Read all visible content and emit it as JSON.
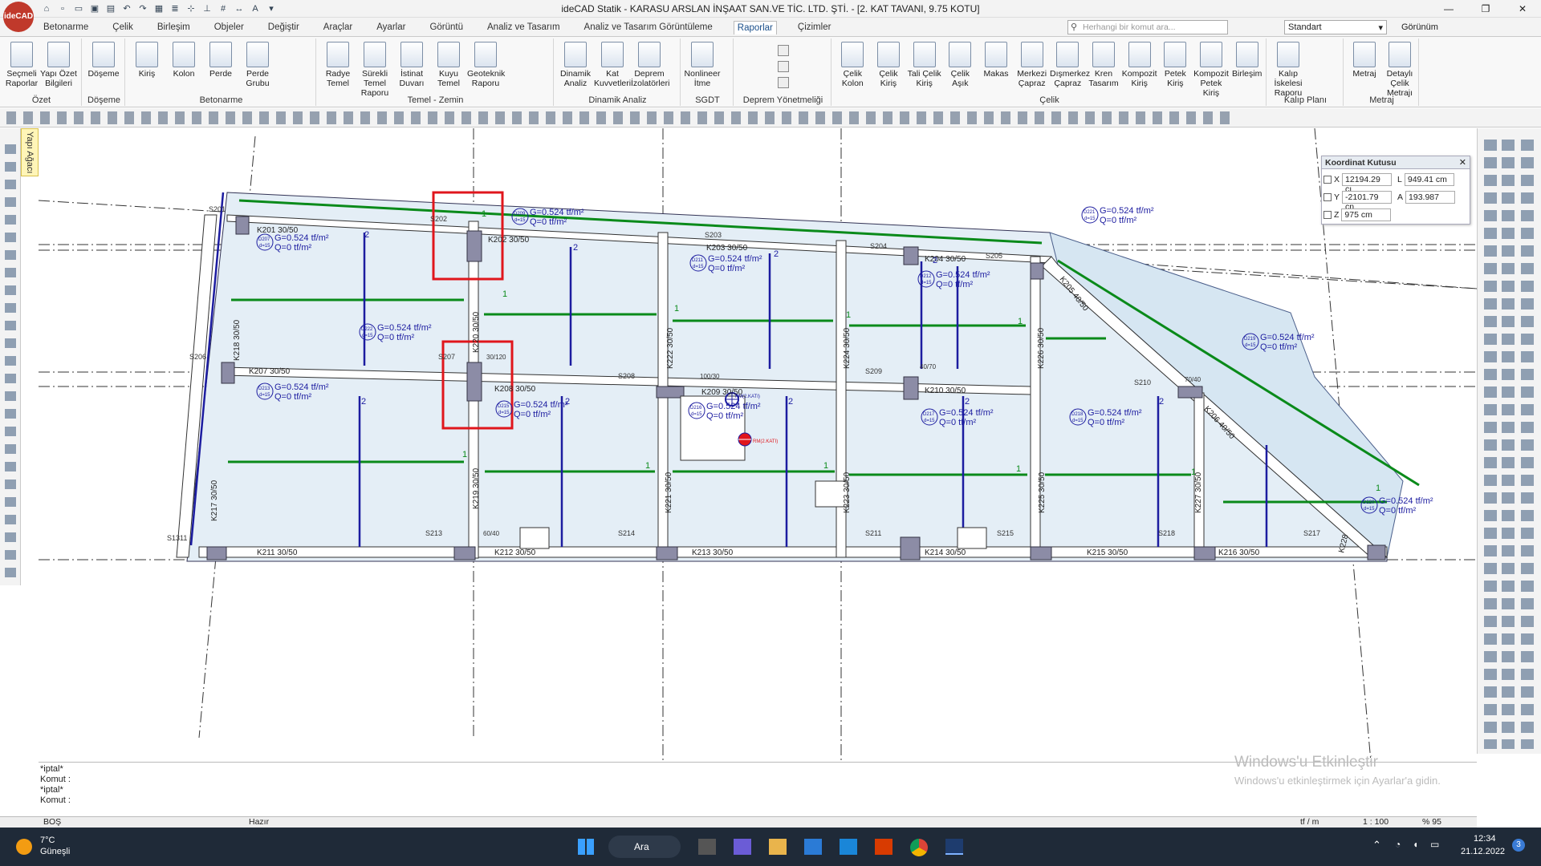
{
  "app": {
    "logo_text": "ideCAD",
    "title": "ideCAD Statik - KARASU ARSLAN İNŞAAT SAN.VE TİC. LTD. ŞTİ. - [2. KAT TAVANI,  9.75 KOTU]",
    "window_controls": [
      "—",
      "❐",
      "✕"
    ]
  },
  "tabs": [
    "Betonarme",
    "Çelik",
    "Birleşim",
    "Objeler",
    "Değiştir",
    "Araçlar",
    "Ayarlar",
    "Görüntü",
    "Analiz ve Tasarım",
    "Analiz ve Tasarım Görüntüleme",
    "Raporlar",
    "Çizimler"
  ],
  "active_tab": "Raporlar",
  "search": {
    "placeholder": "Herhangi bir komut ara..."
  },
  "style_select": "Standart",
  "view_label": "Görünüm",
  "ribbon": {
    "groups": [
      {
        "label": "Özet",
        "buttons": [
          "Seçmeli\nRaporlar",
          "Yapı Özet\nBilgileri"
        ]
      },
      {
        "label": "Döşeme",
        "buttons": [
          "Döşeme"
        ]
      },
      {
        "label": "Betonarme",
        "buttons": [
          "Kiriş",
          "Kolon",
          "Perde",
          "Perde\nGrubu"
        ]
      },
      {
        "label": "Temel - Zemin",
        "buttons": [
          "Radye\nTemel",
          "Sürekli Temel\nRaporu",
          "İstinat\nDuvarı",
          "Kuyu\nTemel",
          "Geoteknik\nRaporu"
        ]
      },
      {
        "label": "Dinamik Analiz",
        "buttons": [
          "Dinamik\nAnaliz",
          "Kat\nKuvvetleri",
          "Deprem\nİzolatörleri"
        ]
      },
      {
        "label": "SGDT",
        "buttons": [
          "Nonlineer\nİtme"
        ]
      },
      {
        "label": "Deprem Yönetmeliği",
        "buttons": []
      },
      {
        "label": "Çelik",
        "buttons": [
          "Çelik\nKolon",
          "Çelik\nKiriş",
          "Tali Çelik\nKiriş",
          "Çelik\nAşık",
          "Makas",
          "Merkezi\nÇapraz",
          "Dışmerkez\nÇapraz",
          "Kren\nTasarım",
          "Kompozit\nKiriş",
          "Petek\nKiriş",
          "Kompozit\nPetek Kiriş",
          "Birleşim"
        ]
      },
      {
        "label": "Kalıp Planı",
        "buttons": [
          "Kalıp İskelesi\nRaporu"
        ]
      },
      {
        "label": "Metraj",
        "buttons": [
          "Metraj",
          "Detaylı Çelik\nMetrajı"
        ]
      }
    ]
  },
  "left_panel_tab": "Yapı Ağacı",
  "coord_box": {
    "title": "Koordinat Kutusu",
    "x_label": "X",
    "x_value": "12194.29 cı",
    "y_label": "Y",
    "y_value": "-2101.79 cn",
    "z_label": "Z",
    "z_value": "975 cm",
    "l_label": "L",
    "l_value": "949.41 cm",
    "a_label": "A",
    "a_value": "193.987"
  },
  "plan": {
    "beams": [
      "K201 30/50",
      "K202 30/50",
      "K203 30/50",
      "K204 30/50",
      "K205 40/50",
      "K206 40/50",
      "K207 30/50",
      "K208 30/50",
      "K209 30/50",
      "K210 30/50",
      "K211 30/50",
      "K212 30/50",
      "K213 30/50",
      "K214 30/50",
      "K215 30/50",
      "K216 30/50",
      "K217 30/50",
      "K218 30/50",
      "K219 30/50",
      "K220 30/50",
      "K221 30/50",
      "K222 30/50",
      "K223 30/50",
      "K224 30/50",
      "K225 30/50",
      "K226 30/50",
      "K227 30/50",
      "K228"
    ],
    "load_g": "G=0.524 tf/m²",
    "load_q": "Q=0 tf/m²",
    "slab_d": "d=15",
    "slabs": [
      "D207",
      "D209",
      "D211",
      "D212",
      "D213",
      "D215",
      "D216",
      "D217",
      "D218",
      "D219",
      "D220",
      "D221",
      "D222"
    ],
    "columns": [
      "S201",
      "S202",
      "S203",
      "S204",
      "S205",
      "S206",
      "S207",
      "S208",
      "S209",
      "S210",
      "S211",
      "S213",
      "S214",
      "S215",
      "S217",
      "S218",
      "S1311"
    ],
    "sizes": [
      "30/120",
      "100/30",
      "40/70",
      "70/40",
      "60/40"
    ],
    "marker_labels": [
      "KM(2.KATI)",
      "RM(2.KATI)"
    ],
    "one": "1",
    "two": "2"
  },
  "command_lines": [
    "*iptal*",
    "Komut :",
    "*iptal*",
    "Komut :"
  ],
  "status": {
    "left": "BOŞ",
    "mid": "Hazır",
    "unit": "tf / m",
    "scale": "1 : 100",
    "zoom": "% 95"
  },
  "watermark": {
    "title": "Windows'u Etkinleştir",
    "sub": "Windows'u etkinleştirmek için Ayarlar'a gidin."
  },
  "taskbar": {
    "weather_temp": "7°C",
    "weather_desc": "Güneşli",
    "search": "Ara",
    "time": "12:34",
    "date": "21.12.2022",
    "notif": "3"
  },
  "colors": {
    "accent": "#1a4f8a",
    "beam_blue": "#1c1ca0",
    "rebar_green": "#0a8a1a",
    "highlight_red": "#e0161c",
    "column_fill": "#8c8ca6"
  }
}
